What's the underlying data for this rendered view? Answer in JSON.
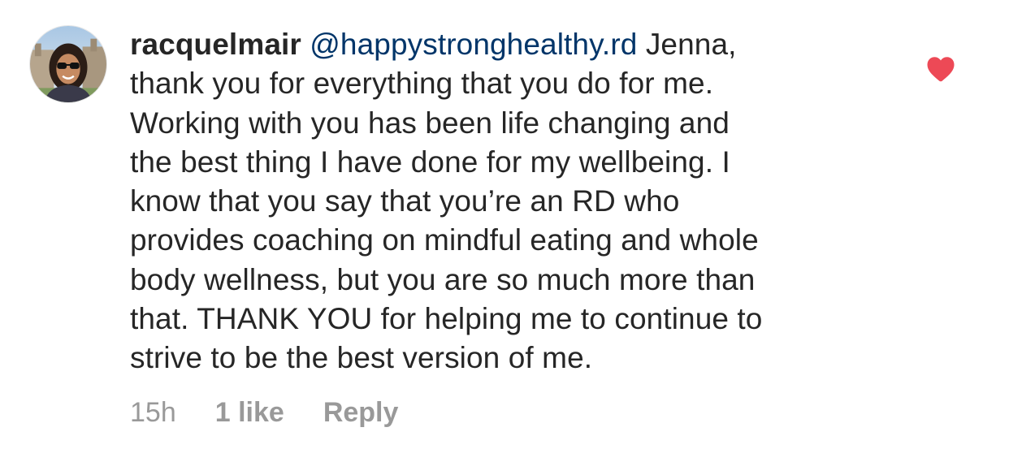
{
  "comment": {
    "username": "racquelmair",
    "mention": "@happystronghealthy.rd",
    "text": "Jenna,\nthank you for everything that you do for me.\nWorking with you has been life changing and\nthe best thing I have done for my wellbeing. I\nknow that you say that you’re an RD who\nprovides coaching on mindful eating and whole\nbody wellness, but you are so much more than\nthat. THANK YOU for helping me to continue to\nstrive to be the best version of me.",
    "timestamp": "15h",
    "likes": "1 like",
    "reply_label": "Reply",
    "liked": true
  },
  "icons": {
    "avatar": "profile-photo",
    "like": "heart-icon"
  },
  "colors": {
    "text": "#262626",
    "mention": "#003569",
    "meta": "#999999",
    "heart": "#ed4956"
  }
}
